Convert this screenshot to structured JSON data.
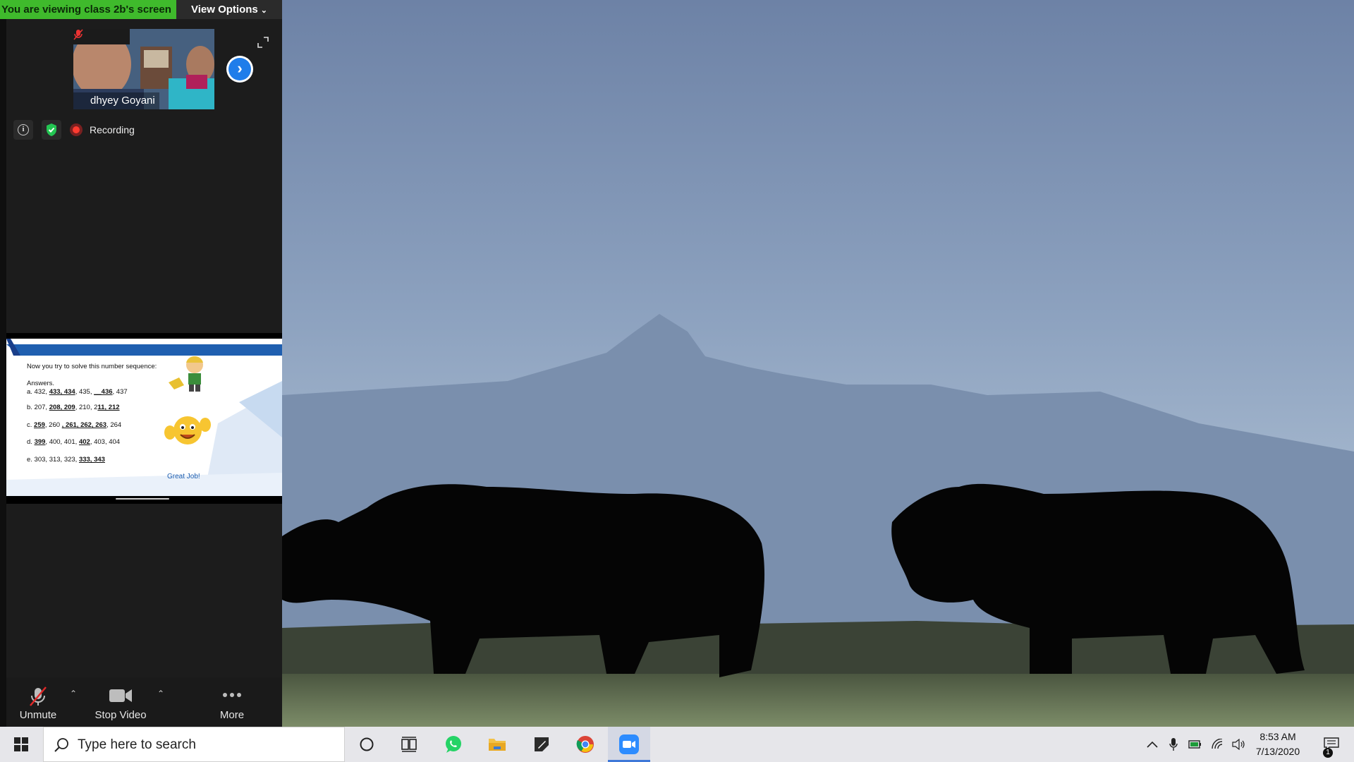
{
  "banner": {
    "viewing_text": "You are viewing class 2b's screen",
    "view_options_label": "View Options"
  },
  "participant": {
    "name": "dhyey Goyani"
  },
  "status": {
    "recording_label": "Recording"
  },
  "slide": {
    "prompt": "Now you try to solve this number sequence:",
    "answers_label": "Answers.",
    "rows": [
      {
        "prefix": "a. 432, ",
        "answers": "433, 434",
        "middle": ", 435, ",
        "answers2": "__436",
        "suffix": ", 437"
      },
      {
        "prefix": "b. 207, ",
        "answers": "208, 209",
        "middle": ", 210, 2",
        "answers2": "11, 212",
        "suffix": ""
      },
      {
        "prefix": "c. ",
        "answers": "259",
        "middle": ", 260 ",
        "answers2": ", 261, 262, 263",
        "suffix": ", 264"
      },
      {
        "prefix": "d.  ",
        "answers": "399",
        "middle": ", 400, 401, ",
        "answers2": "402",
        "suffix": ", 403, 404"
      },
      {
        "prefix": "e. 303, 313, 323, ",
        "answers": "333, 343",
        "middle": "",
        "answers2": "",
        "suffix": ""
      }
    ],
    "great_job": "Great Job!"
  },
  "controls": {
    "unmute_label": "Unmute",
    "stop_video_label": "Stop Video",
    "more_label": "More"
  },
  "taskbar": {
    "search_placeholder": "Type here to search",
    "time": "8:53 AM",
    "date": "7/13/2020",
    "notification_count": "1"
  },
  "colors": {
    "banner_green": "#3fba2c",
    "zoom_blue": "#1f7dea",
    "recording_red": "#ff3b30"
  }
}
